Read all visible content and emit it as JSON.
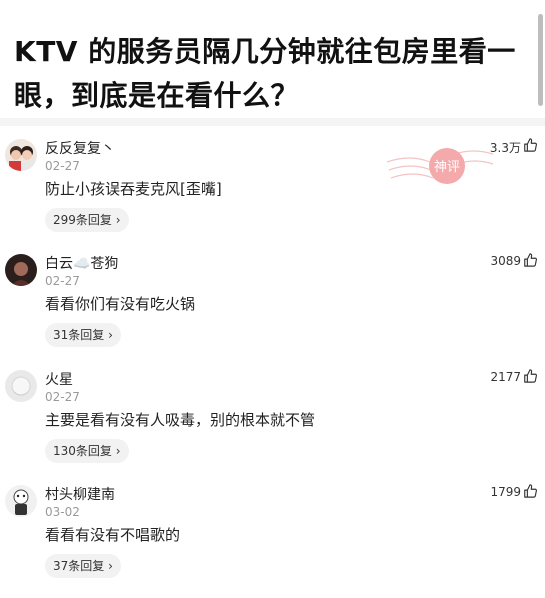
{
  "post": {
    "title": "KTV 的服务员隔几分钟就往包房里看一眼，到底是在看什么？"
  },
  "comments": [
    {
      "name": "反反复复丶",
      "date": "02-27",
      "text": "防止小孩误吞麦克风[歪嘴]",
      "replies": "299条回复 ›",
      "likes": "3.3万"
    },
    {
      "name": "白云☁️苍狗",
      "date": "02-27",
      "text": "看看你们有没有吃火锅",
      "replies": "31条回复 ›",
      "likes": "3089"
    },
    {
      "name": "火星",
      "date": "02-27",
      "text": "主要是看有没有人吸毒，别的根本就不管",
      "replies": "130条回复 ›",
      "likes": "2177"
    },
    {
      "name": "村头柳建南",
      "date": "03-02",
      "text": "看看有没有不唱歌的",
      "replies": "37条回复 ›",
      "likes": "1799"
    }
  ],
  "stamp": {
    "text": "神评"
  },
  "icons": {
    "like": "thumbs-up-icon"
  },
  "colors": {
    "stamp": "#f2a7a9",
    "muted": "#9a9a9a",
    "pill": "#f2f2f2"
  }
}
